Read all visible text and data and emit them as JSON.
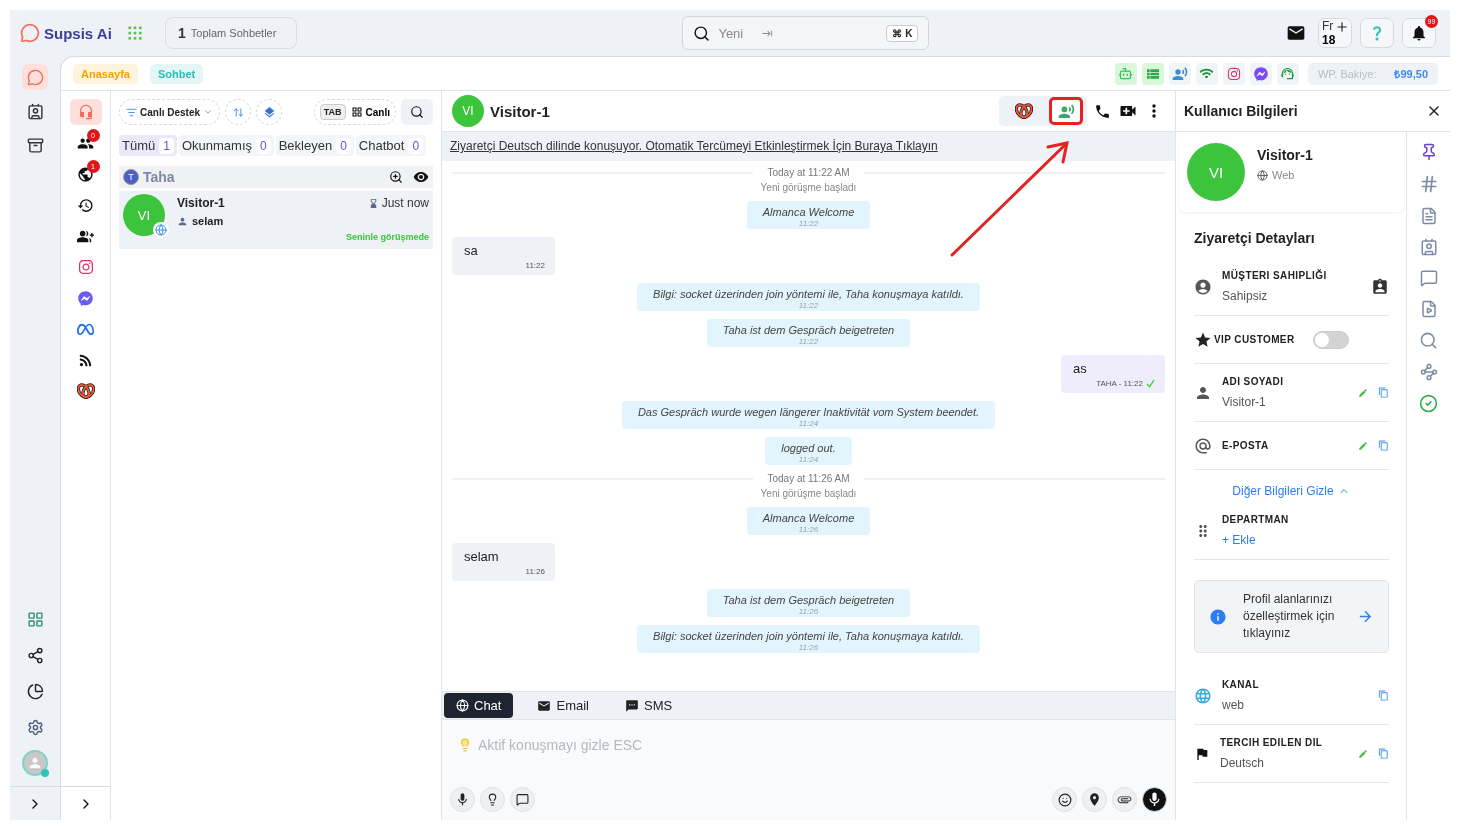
{
  "topbar": {
    "brand": "Supsis Ai",
    "total_chats": {
      "count": "1",
      "label": "Toplam Sohbetler"
    },
    "search": {
      "placeholder": "Yeni",
      "shortcut": "⌘ K"
    },
    "calendar": {
      "month": "Fr",
      "day": "18"
    },
    "notifications": {
      "badge": "99"
    }
  },
  "rail": {
    "items": [
      {
        "kind": "chat",
        "selected": true
      },
      {
        "kind": "contacts",
        "selected": false
      },
      {
        "kind": "archive",
        "selected": false
      }
    ],
    "bottom": [
      {
        "kind": "apps"
      },
      {
        "kind": "share"
      },
      {
        "kind": "reports"
      },
      {
        "kind": "settings"
      }
    ]
  },
  "breadcrumbs": [
    {
      "label": "Anasayfa",
      "color": "#f5a200"
    },
    {
      "label": "Sohbet",
      "color": "#2bbfb3"
    }
  ],
  "channels": [
    {
      "kind": "bot",
      "active": true
    },
    {
      "kind": "list",
      "active": true
    },
    {
      "kind": "voice",
      "active": false
    },
    {
      "kind": "wifi",
      "active": false
    },
    {
      "kind": "instagram",
      "active": false
    },
    {
      "kind": "messenger",
      "active": false
    },
    {
      "kind": "support",
      "active": false
    }
  ],
  "balance": {
    "label": "WP. Bakiye:",
    "value": "₺99,50"
  },
  "subrail": [
    {
      "kind": "support",
      "selected": true
    },
    {
      "kind": "visitors",
      "selected": false,
      "badge": "0"
    },
    {
      "kind": "web",
      "selected": false,
      "badge": "1"
    },
    {
      "kind": "history",
      "selected": false
    },
    {
      "kind": "team",
      "selected": false
    },
    {
      "kind": "instagram",
      "selected": false
    },
    {
      "kind": "messenger",
      "selected": false
    },
    {
      "kind": "meta",
      "selected": false
    },
    {
      "kind": "rss",
      "selected": false
    },
    {
      "kind": "knot",
      "selected": false
    }
  ],
  "chat_list": {
    "filter": "Canlı Destek",
    "tab_key": "TAB",
    "mode": "Canlı",
    "tabs": [
      {
        "label": "Tümü",
        "count": "1",
        "selected": true
      },
      {
        "label": "Okunmamış",
        "count": "0",
        "selected": false
      },
      {
        "label": "Bekleyen",
        "count": "0",
        "selected": false
      },
      {
        "label": "Chatbot",
        "count": "0",
        "selected": false
      }
    ],
    "groups": [
      {
        "initial": "T",
        "name": "Taha",
        "chats": [
          {
            "initials": "VI",
            "name": "Visitor-1",
            "time": "Just now",
            "preview": "selam",
            "status": "Seninle görüşmede",
            "selected": true
          }
        ]
      }
    ]
  },
  "chat": {
    "initials": "VI",
    "name": "Visitor-1",
    "actions": [
      {
        "kind": "knot",
        "highlighted": false
      },
      {
        "kind": "voice",
        "highlighted": true
      },
      {
        "kind": "phone",
        "highlighted": false
      },
      {
        "kind": "video",
        "highlighted": false
      },
      {
        "kind": "more",
        "highlighted": false
      }
    ],
    "banner": "Ziyaretçi Deutsch dilinde konuşuyor. Otomatik Tercümeyi Etkinleştirmek İçin Buraya Tıklayın",
    "messages": [
      {
        "kind": "divider",
        "text": "Today at 11:22 AM"
      },
      {
        "kind": "note",
        "text": "Yeni görüşme başladı"
      },
      {
        "kind": "system",
        "text": "Almanca Welcome",
        "time": "11:22"
      },
      {
        "kind": "incoming",
        "text": "sa",
        "time": "11:22"
      },
      {
        "kind": "system",
        "text": "Bilgi: socket üzerinden join yöntemi ile, Taha konuşmaya katıldı.",
        "time": "11:22"
      },
      {
        "kind": "system",
        "text": "Taha ist dem Gespräch beigetreten",
        "time": "11:22"
      },
      {
        "kind": "outgoing",
        "text": "as",
        "time": "TAHA - 11:22",
        "read": true
      },
      {
        "kind": "system",
        "text": "Das Gespräch wurde wegen längerer Inaktivität vom System beendet.",
        "time": "11:24"
      },
      {
        "kind": "system",
        "text": "logged out.",
        "time": "11:24"
      },
      {
        "kind": "divider",
        "text": "Today at 11:26 AM"
      },
      {
        "kind": "note",
        "text": "Yeni görüşme başladı"
      },
      {
        "kind": "system",
        "text": "Almanca Welcome",
        "time": "11:26"
      },
      {
        "kind": "incoming",
        "text": "selam",
        "time": "11:26"
      },
      {
        "kind": "system",
        "text": "Taha ist dem Gespräch beigetreten",
        "time": "11:26"
      },
      {
        "kind": "system",
        "text": "Bilgi: socket üzerinden join yöntemi ile, Taha konuşmaya katıldı.",
        "time": "11:26"
      }
    ],
    "composer": {
      "tabs": [
        {
          "kind": "chat",
          "label": "Chat",
          "selected": true
        },
        {
          "kind": "email",
          "label": "Email",
          "selected": false
        },
        {
          "kind": "sms",
          "label": "SMS",
          "selected": false
        }
      ],
      "placeholder": "Aktif konuşmayı gizle ESC",
      "tools_left": [
        {
          "kind": "mic"
        },
        {
          "kind": "idea"
        },
        {
          "kind": "canned"
        }
      ],
      "tools_right": [
        {
          "kind": "emoji"
        },
        {
          "kind": "location"
        },
        {
          "kind": "attach"
        },
        {
          "kind": "record"
        }
      ]
    }
  },
  "profile": {
    "title": "Kullanıcı Bilgileri",
    "initials": "VI",
    "name": "Visitor-1",
    "channel": "Web",
    "section": "Ziyaretçi Detayları",
    "fields": [
      {
        "kind": "owner",
        "label": "MÜŞTERI SAHIPLIĞI",
        "value": "Sahipsiz",
        "editable": false,
        "copyable": false
      },
      {
        "kind": "vip",
        "label": "VIP CUSTOMER",
        "on": false
      },
      {
        "kind": "name",
        "label": "ADI SOYADI",
        "value": "Visitor-1",
        "editable": true,
        "copyable": true
      },
      {
        "kind": "email",
        "label": "E-POSTA",
        "editable": true,
        "copyable": true
      }
    ],
    "toggle_link": "Diğer Bilgileri Gizle",
    "extra_fields": [
      {
        "kind": "department",
        "label": "DEPARTMAN",
        "action": "+ Ekle"
      }
    ],
    "info": "Profil alanlarınızı özelleştirmek için tıklayınız",
    "more_fields": [
      {
        "kind": "channel",
        "label": "KANAL",
        "value": "web",
        "editable": false,
        "copyable": true
      },
      {
        "kind": "language",
        "label": "TERCIH EDILEN DIL",
        "value": "Deutsch",
        "editable": true,
        "copyable": true
      }
    ]
  },
  "side_tools": [
    {
      "kind": "pin"
    },
    {
      "kind": "hash"
    },
    {
      "kind": "document"
    },
    {
      "kind": "contacts"
    },
    {
      "kind": "feedback"
    },
    {
      "kind": "media"
    },
    {
      "kind": "search"
    },
    {
      "kind": "flow"
    },
    {
      "kind": "check"
    }
  ]
}
